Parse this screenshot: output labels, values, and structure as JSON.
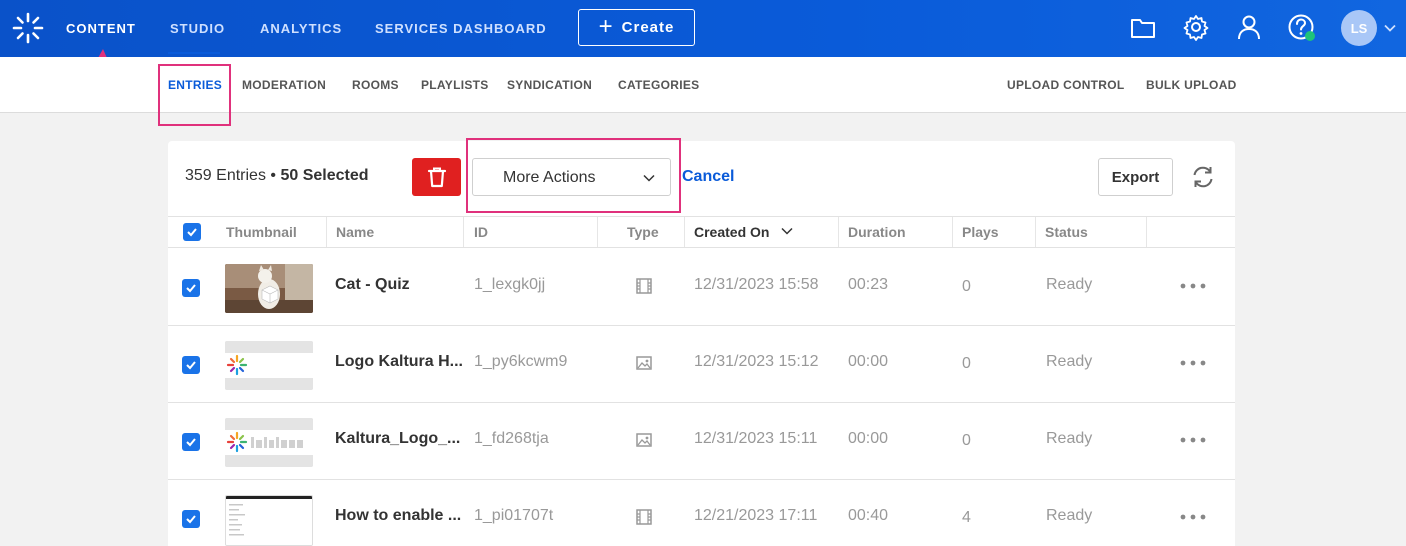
{
  "colors": {
    "brand": "#0a5bd9",
    "delete": "#e02020",
    "highlight": "#e0317c",
    "checkbox": "#1a73e8",
    "online_dot": "#1ec37a"
  },
  "topbar": {
    "nav": [
      "CONTENT",
      "STUDIO",
      "ANALYTICS",
      "SERVICES DASHBOARD"
    ],
    "create_label": "Create",
    "icons": [
      "folder-icon",
      "gear-icon",
      "user-icon",
      "help-icon"
    ],
    "avatar_initials": "LS"
  },
  "subnav": {
    "left": [
      "ENTRIES",
      "MODERATION",
      "ROOMS",
      "PLAYLISTS",
      "SYNDICATION",
      "CATEGORIES"
    ],
    "right": [
      "UPLOAD CONTROL",
      "BULK UPLOAD"
    ]
  },
  "toolbar": {
    "entries_count": "359 Entries",
    "separator": "•",
    "selected": "50 Selected",
    "more_actions": "More Actions",
    "cancel": "Cancel",
    "export": "Export"
  },
  "table": {
    "columns": [
      "Thumbnail",
      "Name",
      "ID",
      "Type",
      "Created On",
      "Duration",
      "Plays",
      "Status"
    ],
    "rows": [
      {
        "name": "Cat - Quiz",
        "id": "1_lexgk0jj",
        "type": "video",
        "created": "12/31/2023 15:58",
        "duration": "00:23",
        "plays": "0",
        "status": "Ready"
      },
      {
        "name": "Logo Kaltura H...",
        "id": "1_py6kcwm9",
        "type": "image",
        "created": "12/31/2023 15:12",
        "duration": "00:00",
        "plays": "0",
        "status": "Ready"
      },
      {
        "name": "Kaltura_Logo_...",
        "id": "1_fd268tja",
        "type": "image",
        "created": "12/31/2023 15:11",
        "duration": "00:00",
        "plays": "0",
        "status": "Ready"
      },
      {
        "name": "How to enable ...",
        "id": "1_pi01707t",
        "type": "video",
        "created": "12/21/2023 17:11",
        "duration": "00:40",
        "plays": "4",
        "status": "Ready"
      }
    ]
  }
}
